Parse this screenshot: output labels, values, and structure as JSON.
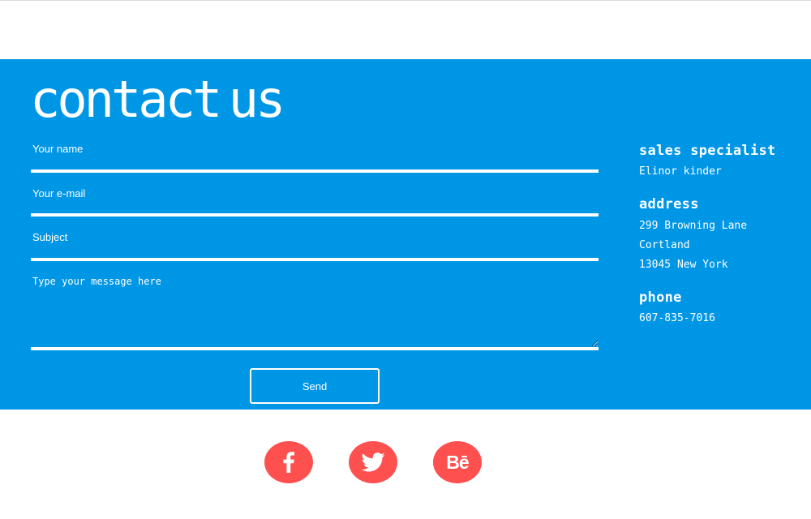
{
  "page": {
    "title": "contact us"
  },
  "form": {
    "name_label": "Your name",
    "email_label": "Your e-mail",
    "subject_label": "Subject",
    "message_placeholder": "Type your message here",
    "send_label": "Send"
  },
  "contact_info": {
    "sales_heading": "sales specialist",
    "sales_name": "Elinor kinder",
    "address_heading": "address",
    "address_line1": "299 Browning Lane",
    "address_line2": "Cortland",
    "address_line3": "13045 New York",
    "phone_heading": "phone",
    "phone_number": "607-835-7016"
  },
  "social": {
    "facebook_icon": "facebook-icon",
    "twitter_icon": "twitter-icon",
    "behance_icon": "behance-icon",
    "behance_text": "Bē"
  },
  "colors": {
    "section_bg": "#0096e6",
    "social_bg": "#ff5050",
    "text": "#ffffff"
  }
}
